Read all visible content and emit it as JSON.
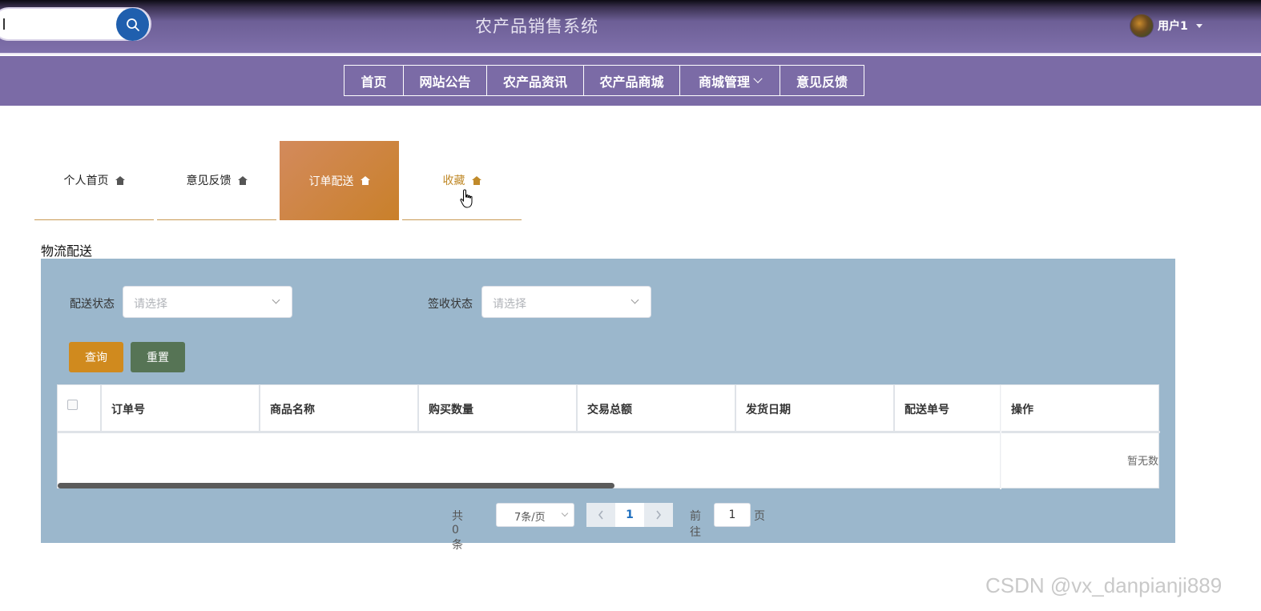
{
  "header": {
    "site_title": "农产品销售系统",
    "user_name": "用户1",
    "search_icon": "search-icon"
  },
  "nav": {
    "items": [
      {
        "label": "首页"
      },
      {
        "label": "网站公告"
      },
      {
        "label": "农产品资讯"
      },
      {
        "label": "农产品商城"
      },
      {
        "label": "商城管理"
      },
      {
        "label": "意见反馈"
      }
    ]
  },
  "tabs": [
    {
      "label": "个人首页"
    },
    {
      "label": "意见反馈"
    },
    {
      "label": "订单配送"
    },
    {
      "label": "收藏"
    }
  ],
  "section": {
    "title": "物流配送"
  },
  "filters": {
    "delivery_status_label": "配送状态",
    "delivery_status_placeholder": "请选择",
    "receipt_status_label": "签收状态",
    "receipt_status_placeholder": "请选择"
  },
  "actions": {
    "query": "查询",
    "reset": "重置"
  },
  "table": {
    "columns": [
      "订单号",
      "商品名称",
      "购买数量",
      "交易总额",
      "发货日期",
      "配送单号",
      "操作"
    ],
    "empty_text": "暂无数"
  },
  "pagination": {
    "total_text": "共 0 条",
    "page_size": "7条/页",
    "current_page": "1",
    "goto_label": "前往",
    "goto_value": "1",
    "page_suffix": "页"
  },
  "watermark": "CSDN @vx_danpianji889",
  "colors": {
    "header": "#7f70ab",
    "navbar": "#7b6ba6",
    "active_tab": "#c9802a",
    "panel": "#9bb7cc",
    "query_button": "#d08a1e",
    "reset_button": "#567455",
    "search_button": "#1f5fae"
  }
}
